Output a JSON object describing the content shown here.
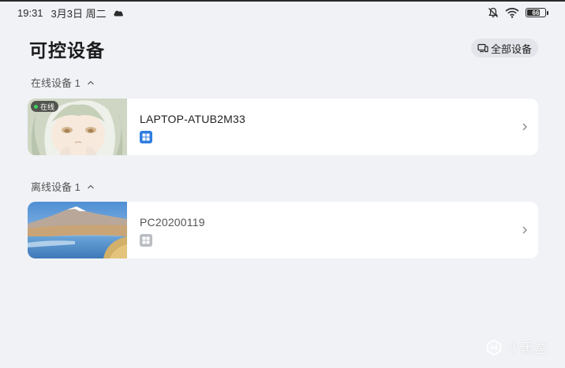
{
  "status_bar": {
    "time": "19:31",
    "date": "3月3日 周二",
    "battery_level": "66"
  },
  "header": {
    "title": "可控设备",
    "all_devices_label": "全部设备"
  },
  "sections": {
    "online": {
      "title": "在线设备 1"
    },
    "offline": {
      "title": "离线设备 1"
    }
  },
  "devices": [
    {
      "name": "LAPTOP-ATUB2M33",
      "status_label": "在线",
      "os_icon": "windows-icon",
      "badge_color": "#2f7de1"
    },
    {
      "name": "PC20200119",
      "os_icon": "windows-icon",
      "badge_color": "#b9bcc2"
    }
  ],
  "colors": {
    "background": "#f0f2f6",
    "card": "#ffffff",
    "online_dot": "#3ad35e"
  },
  "watermark": {
    "text": "小黑盒"
  }
}
